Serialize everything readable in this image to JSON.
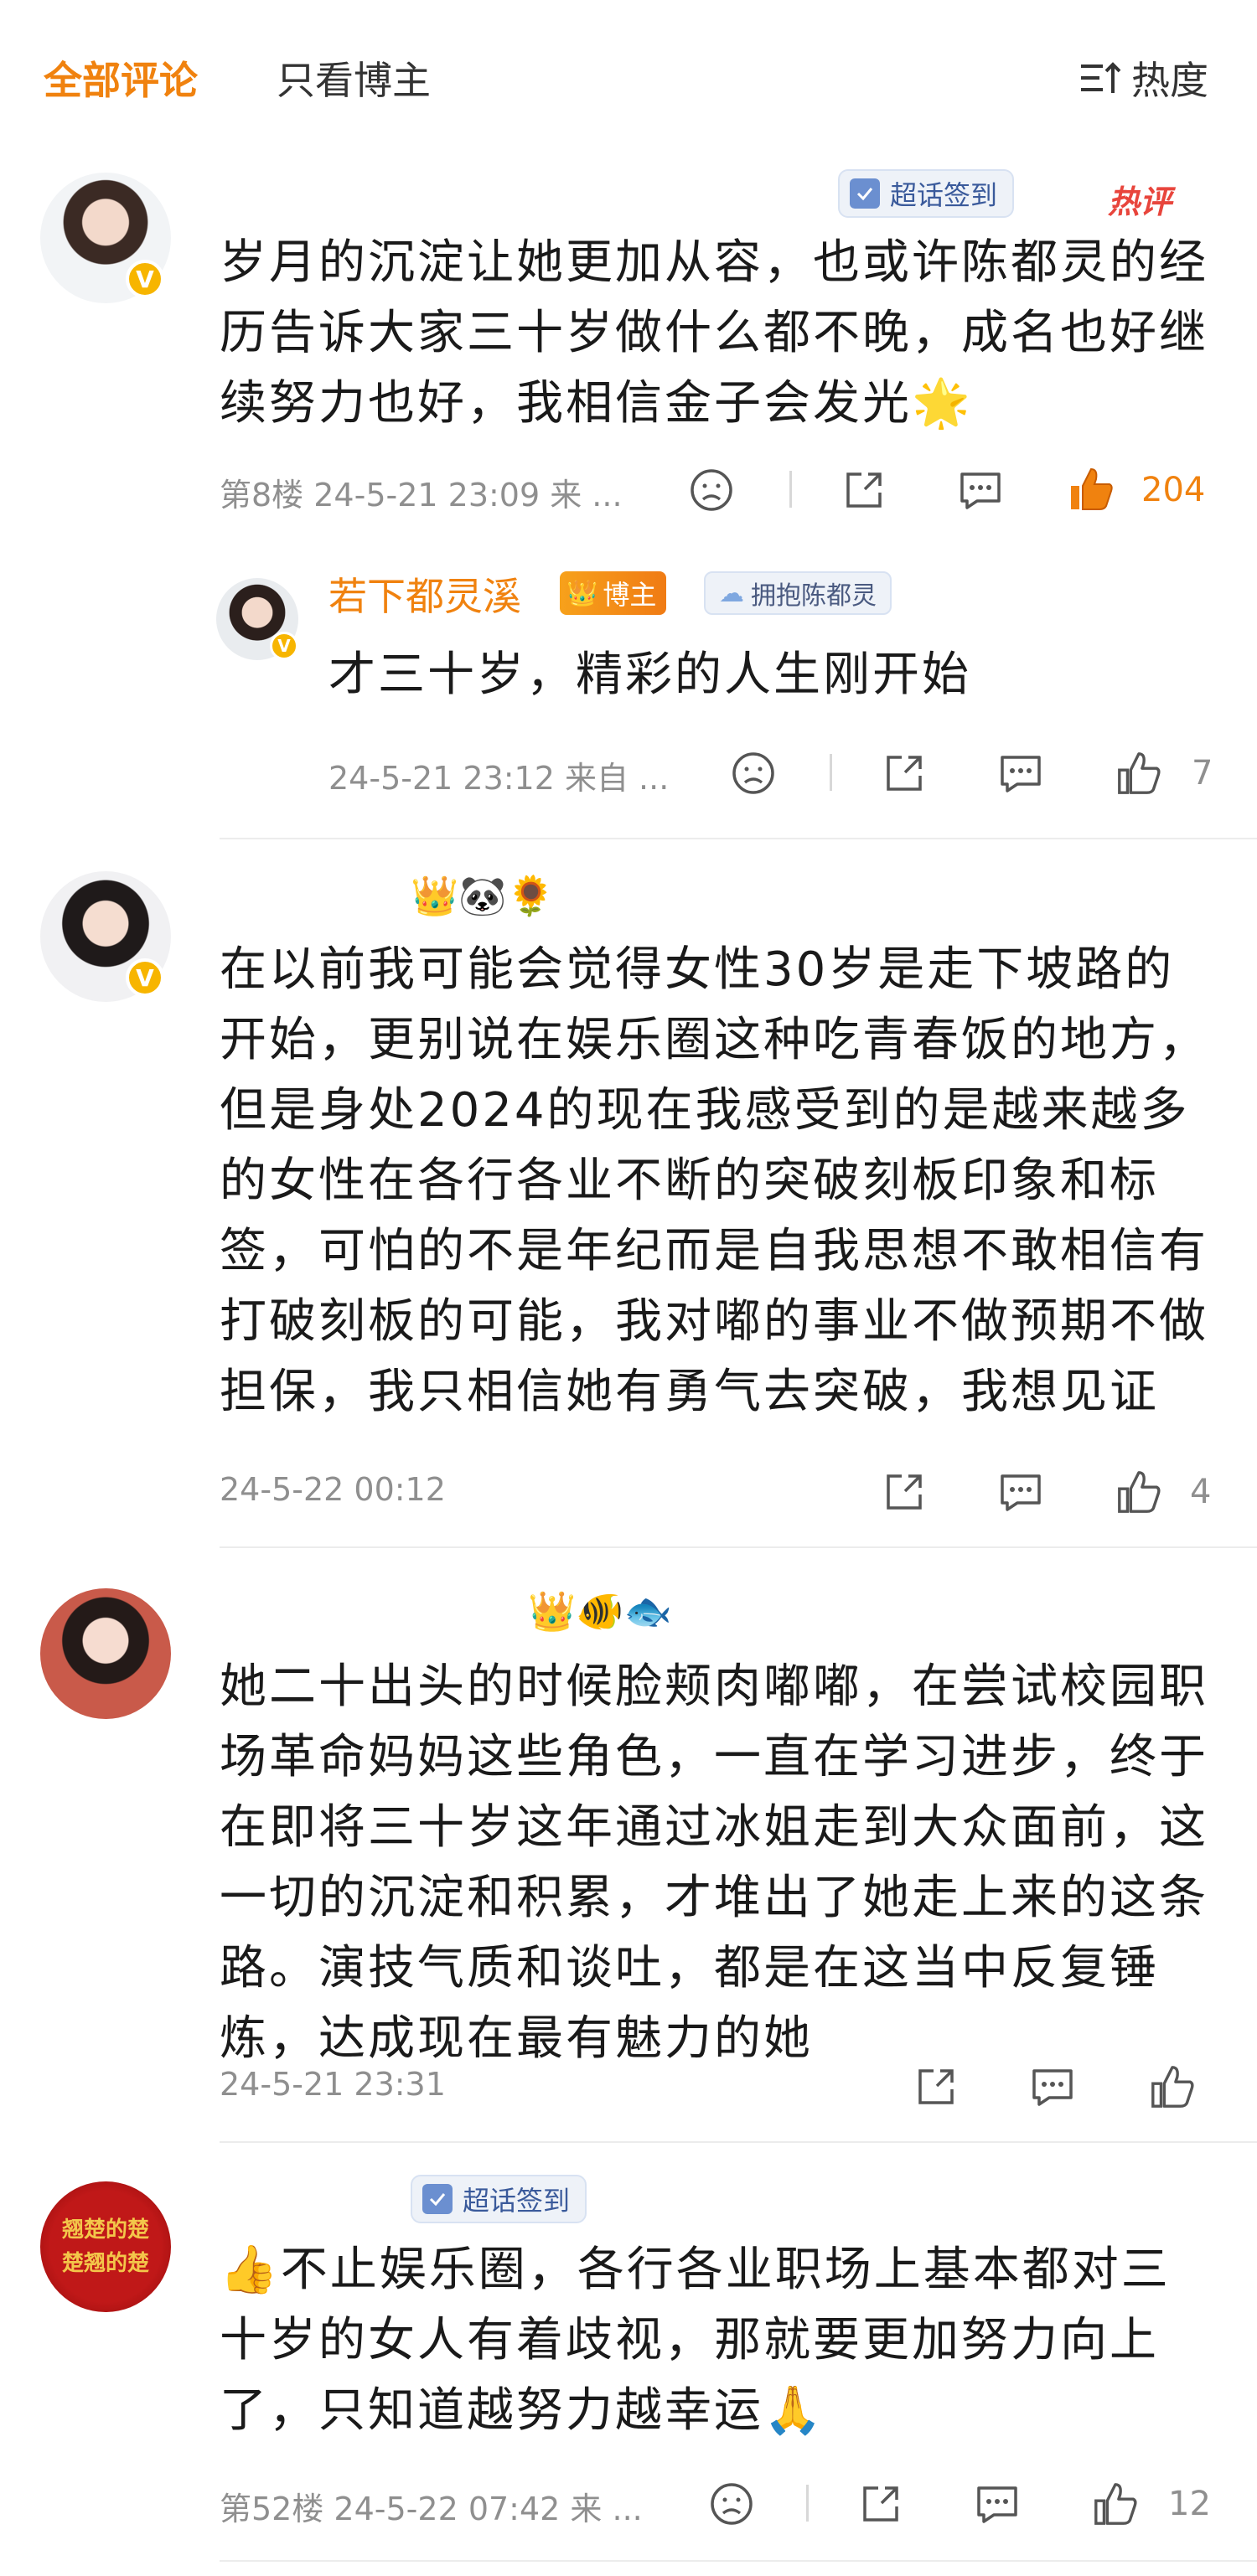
{
  "header": {
    "tab_all": "全部评论",
    "tab_blogger": "只看博主",
    "sort_label": "热度"
  },
  "comments": [
    {
      "chip": "超话签到",
      "hot_label": "热评",
      "text": "岁月的沉淀让她更加从容，也或许陈都灵的经历告诉大家三十岁做什么都不晚，成名也好继续努力也好，我相信金子会发光🌟",
      "meta": "第8楼  24-5-21 23:09  来 ...",
      "likes": "204",
      "reply": {
        "name": "若下都灵溪",
        "host_badge": "博主",
        "fan_badge": "拥抱陈都灵",
        "text": "才三十岁，精彩的人生刚开始",
        "meta": "24-5-21 23:12  来自 ...",
        "likes": "7"
      }
    },
    {
      "emojis": "👑🐼🌻",
      "text": "在以前我可能会觉得女性30岁是走下坡路的开始，更别说在娱乐圈这种吃青春饭的地方，但是身处2024的现在我感受到的是越来越多的女性在各行各业不断的突破刻板印象和标签，可怕的不是年纪而是自我思想不敢相信有打破刻板的可能，我对嘟的事业不做预期不做担保，我只相信她有勇气去突破，我想见证",
      "meta": "24-5-22 00:12",
      "likes": "4"
    },
    {
      "emojis": "👑🐠🐟",
      "text": "她二十出头的时候脸颊肉嘟嘟，在尝试校园职场革命妈妈这些角色，一直在学习进步，终于在即将三十岁这年通过冰姐走到大众面前，这一切的沉淀和积累，才堆出了她走上来的这条路。演技气质和谈吐，都是在这当中反复锤炼，达成现在最有魅力的她",
      "meta": "24-5-21 23:31"
    },
    {
      "chip": "超话签到",
      "avatar_text": "翘楚的楚 楚翘的楚",
      "text": "👍不止娱乐圈，各行各业职场上基本都对三十岁的女人有着歧视，那就要更加努力向上了，只知道越努力越幸运🙏",
      "meta": "第52楼  24-5-22 07:42  来 ...",
      "likes": "12"
    }
  ],
  "colors": {
    "accent": "#f0820f",
    "hot": "#e8453c",
    "meta": "#8f8f8f",
    "verify": "#f7b500"
  }
}
